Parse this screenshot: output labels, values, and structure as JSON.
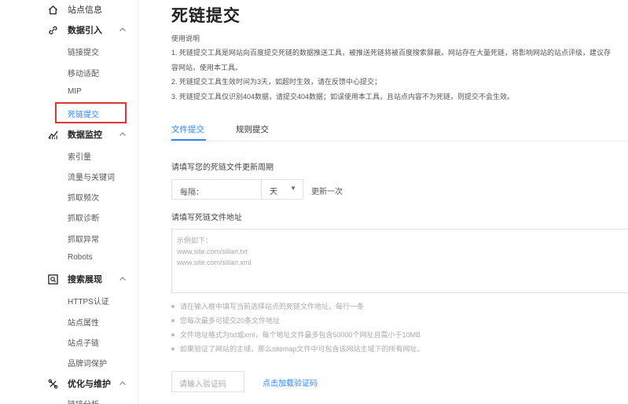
{
  "sidebar": {
    "site_info": "站点信息",
    "data_intro": {
      "title": "数据引入",
      "items": [
        "链接提交",
        "移动适配",
        "MIP",
        "死链提交"
      ]
    },
    "data_monitor": {
      "title": "数据监控",
      "items": [
        "索引量",
        "流量与关键词",
        "抓取频次",
        "抓取诊断",
        "抓取异常",
        "Robots"
      ]
    },
    "search_display": {
      "title": "搜索展现",
      "items": [
        "HTTPS认证",
        "站点属性",
        "站点子链",
        "品牌词保护"
      ]
    },
    "optimize": {
      "title": "优化与维护",
      "items": [
        "链接分析"
      ]
    },
    "active_item": "死链提交",
    "icons": [
      "home-icon",
      "link-icon",
      "chart-icon",
      "search-display-icon",
      "optimize-icon",
      "chevron-up-icon"
    ]
  },
  "main": {
    "title": "死链提交",
    "usage_label": "使用说明",
    "desc_lines": [
      "1. 死链提交工具是网站向百度提交死链的数据推送工具，被推送死链将被百度搜索屏蔽。网站存在大量死链，将影响网站的站点评级，建议存",
      "容网站，使用本工具。",
      "2. 死链提交工具生效时间为3天，如超时生效，请在反馈中心提交；",
      "3. 死链提交工具仅识别404数据，请提交404数据；如误使用本工具，且站点内容不为死链，则提交不会生效。"
    ],
    "tabs": [
      "文件提交",
      "规则提交"
    ],
    "active_tab": "文件提交",
    "period_label": "请填写您的死链文件更新周期",
    "interval_prefix": "每隔：",
    "interval_unit": "天",
    "interval_suffix": "更新一次",
    "file_label": "请填写死链文件地址",
    "textarea_lines": [
      "示例如下：",
      "www.site.com/silian.txt",
      "www.site.com/silian.xml"
    ],
    "hints": [
      "请在输入框中填写当前选择站点的死链文件地址，每行一条",
      "您每次最多可提交20条文件地址",
      "文件地址格式为txt或xml，每个地址文件最多包含50000个网址且需小于10MB",
      "如果验证了网站的主域，那么sitemap文件中可包含该网站主域下的所有网址。"
    ],
    "captcha_placeholder": "请输入验证码",
    "captcha_link": "点击加载验证码"
  },
  "colors": {
    "accent": "#3385ff",
    "highlight_border": "#d9383a"
  }
}
